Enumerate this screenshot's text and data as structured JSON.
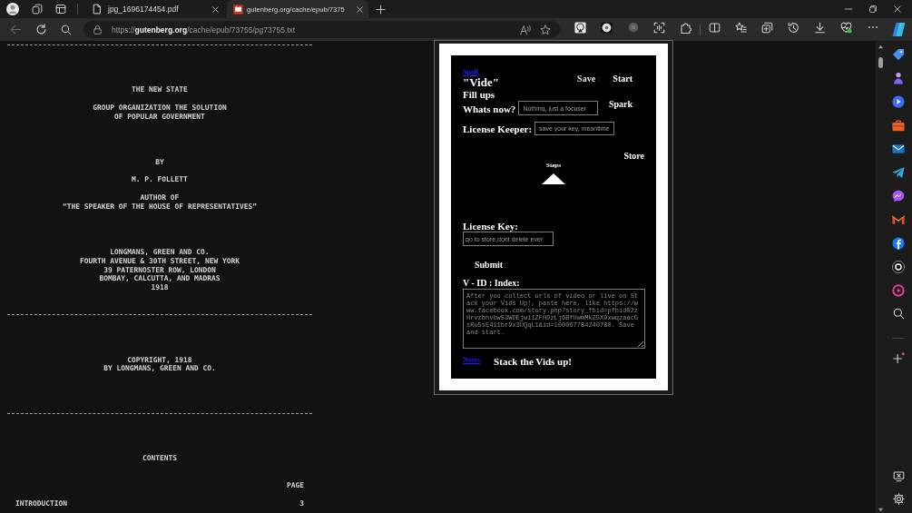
{
  "browser": {
    "tabs": [
      {
        "title": "jpg_1696174454.pdf",
        "kind": "document",
        "selected": false
      },
      {
        "title": "gutenberg.org/cache/epub/7375",
        "kind": "site",
        "selected": true
      }
    ],
    "address": "https://**gutenberg.org**/cache/epub/73755/pg73755.txt"
  },
  "document": {
    "blocks": [
      {
        "kind": "rule"
      },
      {
        "kind": "center",
        "lines": [
          "THE NEW STATE"
        ]
      },
      {
        "kind": "center",
        "lines": [
          "GROUP ORGANIZATION THE SOLUTION",
          "OF POPULAR GOVERNMENT"
        ]
      },
      {
        "kind": "center",
        "lines": [
          "BY"
        ]
      },
      {
        "kind": "center",
        "lines": [
          "M. P. FOLLETT"
        ]
      },
      {
        "kind": "center",
        "lines": [
          "AUTHOR OF",
          "“THE SPEAKER OF THE HOUSE OF REPRESENTATIVES”"
        ]
      },
      {
        "kind": "center",
        "lines": [
          "LONGMANS, GREEN AND CO.",
          "FOURTH AVENUE & 30TH STREET, NEW YORK",
          "39 PATERNOSTER ROW, LONDON",
          "BOMBAY, CALCUTTA, AND MADRAS",
          "1918"
        ]
      },
      {
        "kind": "rule"
      },
      {
        "kind": "center",
        "lines": [
          "COPYRIGHT, 1918",
          "BY LONGMANS, GREEN AND CO."
        ]
      },
      {
        "kind": "rule"
      },
      {
        "kind": "center",
        "lines": [
          "CONTENTS"
        ]
      },
      {
        "kind": "right",
        "lines": [
          "PAGE"
        ]
      },
      {
        "kind": "toc",
        "title": "INTRODUCTION",
        "page": "3"
      }
    ]
  },
  "popup": {
    "spell_link": "Spell",
    "title": "\"Vide\"",
    "save_label": "Save",
    "save_separator": ":",
    "start_button": "Start",
    "fill_ups": "Fill ups",
    "whats_now_label": "Whats now?",
    "whats_now_placeholder": "Nothing, just a focuser",
    "spark_button": "Spark",
    "license_keeper_label": "License Keeper:",
    "license_keeper_placeholder": "save your key, meantime",
    "store_button": "Store",
    "steps_label": "Steps",
    "license_key_label": "License Key:",
    "license_key_placeholder": "go to store,dont delete ever",
    "submit_button": "Submit",
    "index_label": "V - ID : Index:",
    "index_placeholder": "After you collect urls of video or live on Stack your Vids Up!, paste here, like https://www.facebook.com/story.php?story_fbid=pfbid02zHrvzbhvbw53WDEjw11ZFHDzLj6BfUwmMkZ5X9xwqzaacGsRu5sE411br9x3UQqL1&id=100067784240780. Save and start.",
    "notes_link": "Notes",
    "footer_title": "Stack the Vids up!"
  }
}
